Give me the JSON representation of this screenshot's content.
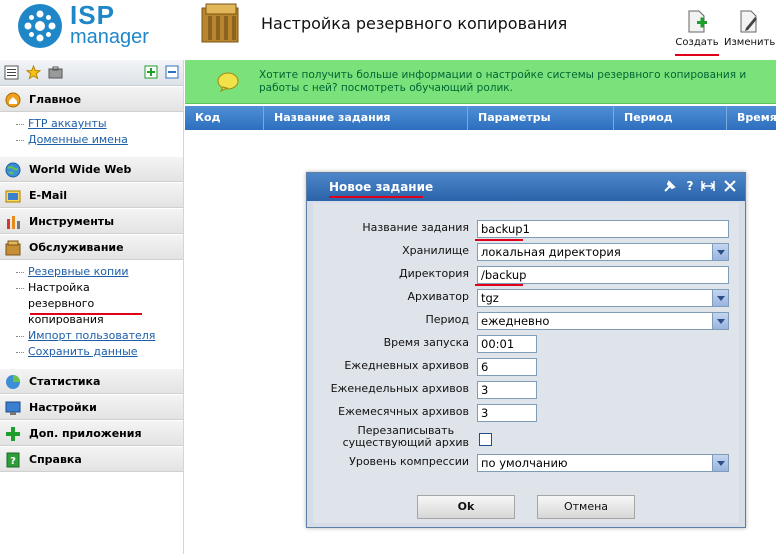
{
  "header": {
    "logo_isp": "ISP",
    "logo_manager": "manager",
    "page_title": "Настройка резервного копирования",
    "create_label": "Создать",
    "edit_label": "Изменить"
  },
  "sidebar": {
    "sections": [
      {
        "label": "Главное",
        "items": [
          "FTP аккаунты",
          "Доменные имена"
        ]
      },
      {
        "label": "World Wide Web",
        "items": []
      },
      {
        "label": "E-Mail",
        "items": []
      },
      {
        "label": "Инструменты",
        "items": []
      },
      {
        "label": "Обслуживание",
        "items": [
          "Резервные копии",
          "Настройка резервного копирования",
          "Импорт пользователя",
          "Сохранить данные"
        ]
      },
      {
        "label": "Статистика",
        "items": []
      },
      {
        "label": "Настройки",
        "items": []
      },
      {
        "label": "Доп. приложения",
        "items": []
      },
      {
        "label": "Справка",
        "items": []
      }
    ]
  },
  "info_bar": {
    "text": "Хотите получить больше информации о настройке системы резервного копирования и работы с ней? посмотреть обучающий ролик."
  },
  "table": {
    "columns": [
      "Код",
      "Название задания",
      "Параметры",
      "Период",
      "Время"
    ]
  },
  "dialog": {
    "title": "Новое задание",
    "fields": {
      "task_name": {
        "label": "Название задания",
        "value": "backup1"
      },
      "storage": {
        "label": "Хранилище",
        "value": "локальная директория"
      },
      "directory": {
        "label": "Директория",
        "value": "/backup"
      },
      "archiver": {
        "label": "Архиватор",
        "value": "tgz"
      },
      "period": {
        "label": "Период",
        "value": "ежедневно"
      },
      "start_time": {
        "label": "Время запуска",
        "value": "00:01"
      },
      "daily": {
        "label": "Ежедневных архивов",
        "value": "6"
      },
      "weekly": {
        "label": "Еженедельных архивов",
        "value": "3"
      },
      "monthly": {
        "label": "Ежемесячных архивов",
        "value": "3"
      },
      "overwrite": {
        "label1": "Перезаписывать",
        "label2": "существующий архив",
        "checked": false
      },
      "compression": {
        "label": "Уровень компрессии",
        "value": "по умолчанию"
      }
    },
    "ok_label": "Ok",
    "cancel_label": "Отмена"
  },
  "colors": {
    "accent_blue": "#2d6fbf",
    "info_green": "#7be27b",
    "highlight_red": "#e0001a"
  }
}
